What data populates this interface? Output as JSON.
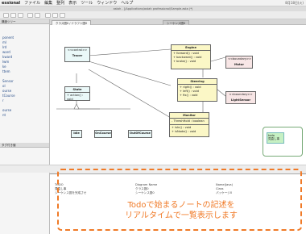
{
  "menu": {
    "app_name": "essional",
    "items": [
      "ファイル",
      "編集",
      "整列",
      "表示",
      "ツール",
      "ウィンドウ",
      "ヘルプ"
    ],
    "clock": "8月18日(火)"
  },
  "window": {
    "title": "astah - [/Applications/astah professional/Sample.asta (*)"
  },
  "left_panel": {
    "header": "構造ツリー",
    "tree_items": [
      "ponent",
      "ml",
      "lrd",
      "ward",
      "kward",
      "lwm",
      "ke",
      "ttem",
      "",
      "Sensor",
      "ol",
      "ourse",
      "tCourse",
      "r",
      "",
      "ourse",
      "nt"
    ],
    "props_header": "タグ付き値",
    "props_items": [
      "",
      "",
      "",
      "",
      "",
      "",
      "",
      "",
      "",
      "",
      "",
      ""
    ]
  },
  "tabs": [
    {
      "label": "クラス図0 / ドラフト図0",
      "active": true
    },
    {
      "label": "シーケンス図0",
      "active": false
    }
  ],
  "diagram": {
    "classes": [
      {
        "id": "tracer",
        "stereotype": "<<control>>",
        "name": "Tracer",
        "ops": []
      },
      {
        "id": "engine",
        "stereotype": "",
        "name": "Engine",
        "ops": [
          "+ forward() : void",
          "+ backward() : void",
          "+ brake() : void"
        ]
      },
      {
        "id": "motor",
        "stereotype": "<<boundary>>",
        "name": "Motor",
        "ops": []
      },
      {
        "id": "state",
        "stereotype": "",
        "name": "State",
        "ops": [
          "+ action() : void"
        ]
      },
      {
        "id": "steering",
        "stereotype": "",
        "name": "Steering",
        "ops": [
          "+ right() : void",
          "+ left() : void",
          "+ fix() : void"
        ]
      },
      {
        "id": "lightsensor",
        "stereotype": "<<boundary>>",
        "name": "LightSensor",
        "ops": []
      },
      {
        "id": "monitor",
        "stereotype": "",
        "name": "Monitor",
        "ops": [
          "- ThreshHold : boolean",
          "+ isIn() : void",
          "+ isNode() : void"
        ]
      },
      {
        "id": "idle",
        "name": "Idle"
      },
      {
        "id": "oncourse",
        "name": "OnCourse"
      },
      {
        "id": "outofcourse",
        "name": "OutOfCourse"
      }
    ],
    "note": {
      "line1": "todo",
      "line2": "見直し事"
    }
  },
  "bottom": {
    "tabs": [
      "",
      "",
      "",
      "",
      "",
      "",
      ""
    ],
    "columns": [
      "TODO",
      "Diagram Name",
      "Name(Java)"
    ],
    "rows": [
      [
        "見直し事",
        "クラス図0",
        "Class"
      ],
      [
        "シーケンス図を完成させ",
        "シーケンス図0",
        "パッケージ0"
      ]
    ]
  },
  "callout": {
    "line1": "Todoで始まるノートの記述を",
    "line2": "リアルタイムで一覧表示します"
  }
}
